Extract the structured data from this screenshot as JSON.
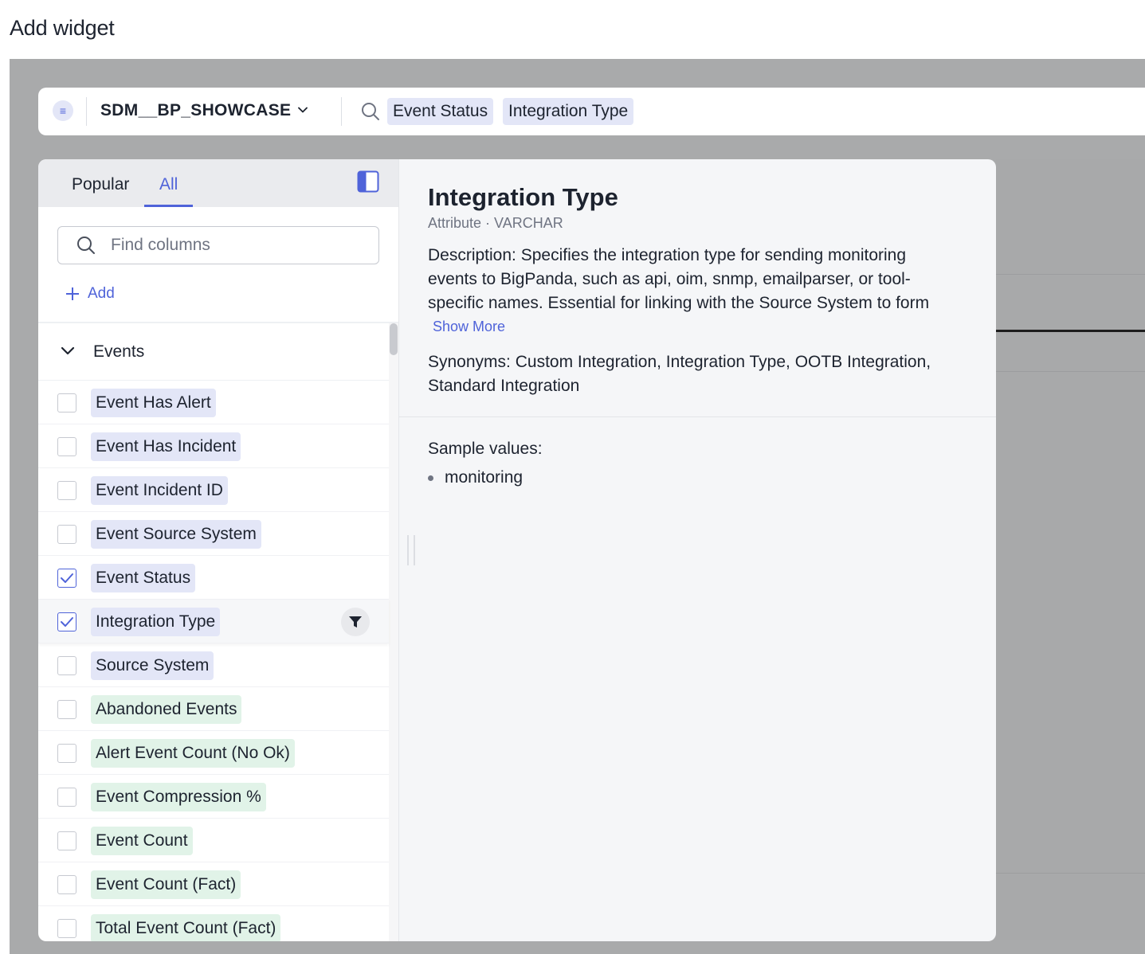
{
  "page": {
    "title": "Add widget"
  },
  "searchbar": {
    "datasource_name": "SDM__BP_SHOWCASE",
    "tokens": [
      "Event Status",
      "Integration Type"
    ]
  },
  "column_panel": {
    "tabs": [
      {
        "label": "Popular",
        "active": false
      },
      {
        "label": "All",
        "active": true
      }
    ],
    "find_placeholder": "Find columns",
    "add_label": "Add",
    "group": "Events",
    "columns": [
      {
        "label": "Event Has Alert",
        "type": "attribute",
        "checked": false
      },
      {
        "label": "Event Has Incident",
        "type": "attribute",
        "checked": false
      },
      {
        "label": "Event Incident ID",
        "type": "attribute",
        "checked": false
      },
      {
        "label": "Event Source System",
        "type": "attribute",
        "checked": false
      },
      {
        "label": "Event Status",
        "type": "attribute",
        "checked": true
      },
      {
        "label": "Integration Type",
        "type": "attribute",
        "checked": true,
        "selected": true
      },
      {
        "label": "Source System",
        "type": "attribute",
        "checked": false
      },
      {
        "label": "Abandoned Events",
        "type": "measure",
        "checked": false
      },
      {
        "label": "Alert Event Count (No Ok)",
        "type": "measure",
        "checked": false
      },
      {
        "label": "Event Compression %",
        "type": "measure",
        "checked": false
      },
      {
        "label": "Event Count",
        "type": "measure",
        "checked": false
      },
      {
        "label": "Event Count (Fact)",
        "type": "measure",
        "checked": false
      },
      {
        "label": "Total Event Count (Fact)",
        "type": "measure",
        "checked": false
      }
    ]
  },
  "detail": {
    "title": "Integration Type",
    "subtitle": "Attribute · VARCHAR",
    "description_label": "Description:",
    "description": "Specifies the integration type for sending monitoring events to BigPanda, such as api, oim, snmp, emailparser, or tool-specific names. Essential for linking with the Source System to form",
    "show_more": "Show More",
    "synonyms_label": "Synonyms:",
    "synonyms": "Custom Integration, Integration Type, OOTB Integration, Standard Integration",
    "sample_label": "Sample values:",
    "sample_values": [
      "monitoring"
    ]
  },
  "colors": {
    "accent": "#4f63d9",
    "attribute_chip": "#e3e6f7",
    "measure_chip": "#e1f3e8"
  }
}
